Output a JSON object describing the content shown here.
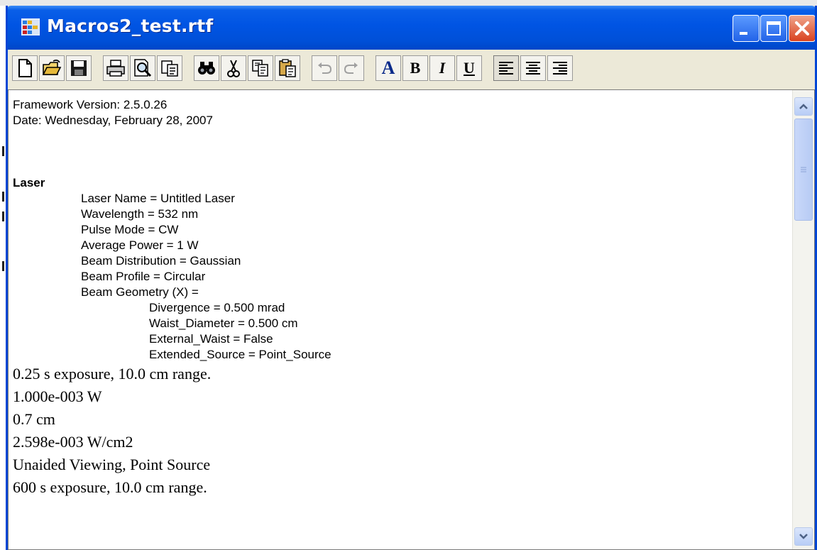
{
  "window": {
    "title": "Macros2_test.rtf"
  },
  "toolbar": {
    "buttons": [
      {
        "name": "new-document-icon"
      },
      {
        "name": "open-folder-icon"
      },
      {
        "name": "save-icon"
      },
      {
        "name": "print-icon"
      },
      {
        "name": "print-preview-icon"
      },
      {
        "name": "copy-format-icon"
      },
      {
        "name": "find-binoculars-icon"
      },
      {
        "name": "cut-icon"
      },
      {
        "name": "copy-icon"
      },
      {
        "name": "paste-icon"
      },
      {
        "name": "undo-icon"
      },
      {
        "name": "redo-icon"
      }
    ],
    "font_label": "A",
    "bold_label": "B",
    "italic_label": "I",
    "underline_label": "U"
  },
  "document": {
    "header_lines": [
      "Framework Version: 2.5.0.26",
      "Date: Wednesday, February 28, 2007"
    ],
    "section_title": "Laser",
    "laser_lines": [
      "Laser Name = Untitled Laser",
      "Wavelength = 532 nm",
      "Pulse Mode = CW",
      "Average Power = 1 W",
      "Beam Distribution = Gaussian",
      "Beam Profile = Circular",
      "Beam Geometry (X) ="
    ],
    "geometry_lines": [
      "Divergence = 0.500 mrad",
      "Waist_Diameter = 0.500 cm",
      "External_Waist = False",
      "Extended_Source = Point_Source"
    ],
    "result_lines": [
      "0.25 s exposure, 10.0 cm range.",
      "1.000e-003 W",
      "0.7 cm",
      "2.598e-003 W/cm2",
      "Unaided Viewing, Point Source",
      "600 s exposure, 10.0 cm range."
    ]
  },
  "colors": {
    "titlebar": "#0054e3",
    "toolbar_bg": "#ece9d8",
    "close_button": "#d9421f"
  }
}
